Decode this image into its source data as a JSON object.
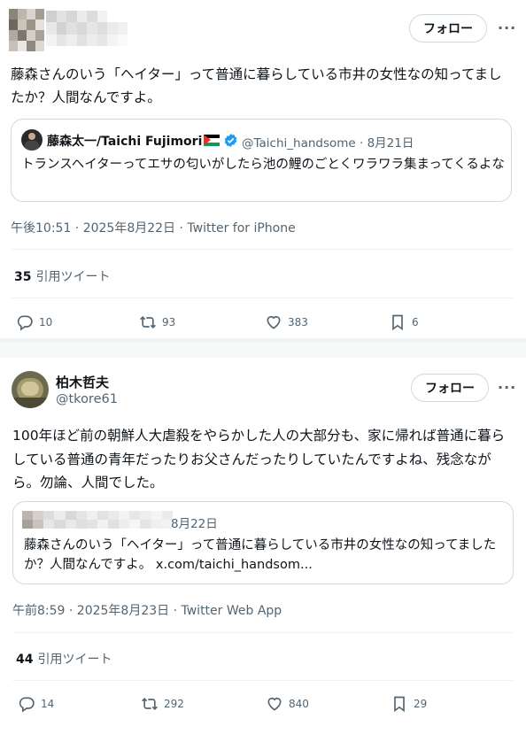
{
  "tweet1": {
    "follow_label": "フォロー",
    "more": "···",
    "text": "藤森さんのいう「ヘイター」って普通に暮らしている市井の女性なの知ってましたか？人間なんですよ。",
    "quote": {
      "author_name": "藤森太一/Taichi Fujimori",
      "handle_date": "@Taichi_handsome · 8月21日",
      "text": "トランスヘイターってエサの匂いがしたら池の鯉のごとくワラワラ集まってくるよな"
    },
    "meta": "午後10:51 · 2025年8月22日 · Twitter for iPhone",
    "quote_count": "35",
    "quote_label": "引用ツイート",
    "replies": "10",
    "retweets": "93",
    "likes": "383",
    "bookmarks": "6"
  },
  "tweet2": {
    "author_name": "柏木哲夫",
    "handle": "@tkore61",
    "follow_label": "フォロー",
    "more": "···",
    "text": "100年ほど前の朝鮮人大虐殺をやらかした人の大部分も、家に帰れば普通に暮らしている普通の青年だったりお父さんだったりしていたんですよね、残念ながら。勿論、人間でした。",
    "quote": {
      "date": "8月22日",
      "text": "藤森さんのいう「ヘイター」って普通に暮らしている市井の女性なの知ってましたか？人間なんですよ。 x.com/taichi_handsom..."
    },
    "meta": "午前8:59 · 2025年8月23日 · Twitter Web App",
    "quote_count": "44",
    "quote_label": "引用ツイート",
    "replies": "14",
    "retweets": "292",
    "likes": "840",
    "bookmarks": "29"
  },
  "colors": {
    "text": "#0f1419",
    "secondary": "#536471",
    "border": "#cfd9de",
    "verified": "#1d9bf0"
  }
}
